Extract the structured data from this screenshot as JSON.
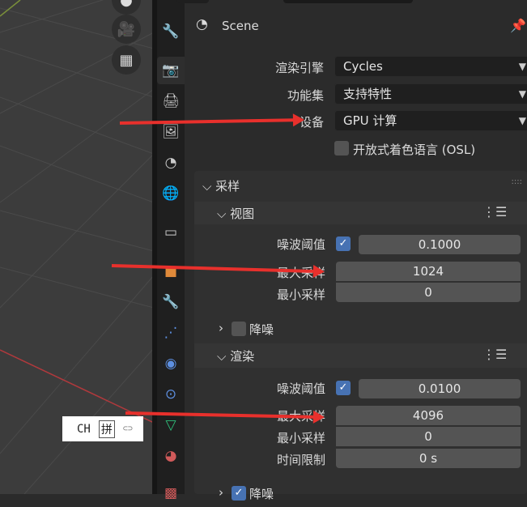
{
  "header": {
    "title": "Scene"
  },
  "render": {
    "engine_label": "渲染引擎",
    "engine_value": "Cycles",
    "feature_label": "功能集",
    "feature_value": "支持特性",
    "device_label": "设备",
    "device_value": "GPU 计算",
    "osl_label": "开放式着色语言 (OSL)"
  },
  "sampling": {
    "title": "采样",
    "viewport": {
      "title": "视图",
      "noise_label": "噪波阈值",
      "noise_value": "0.1000",
      "max_label": "最大采样",
      "max_value": "1024",
      "min_label": "最小采样",
      "min_value": "0",
      "denoise_label": "降噪"
    },
    "render": {
      "title": "渲染",
      "noise_label": "噪波阈值",
      "noise_value": "0.0100",
      "max_label": "最大采样",
      "max_value": "4096",
      "min_label": "最小采样",
      "min_value": "0",
      "time_label": "时间限制",
      "time_value": "0 s",
      "denoise_label": "降噪"
    }
  },
  "ime": {
    "lang": "CH",
    "mode": "拼"
  },
  "colors": {
    "accent": "#4772b3",
    "arrow": "#e8302c"
  }
}
